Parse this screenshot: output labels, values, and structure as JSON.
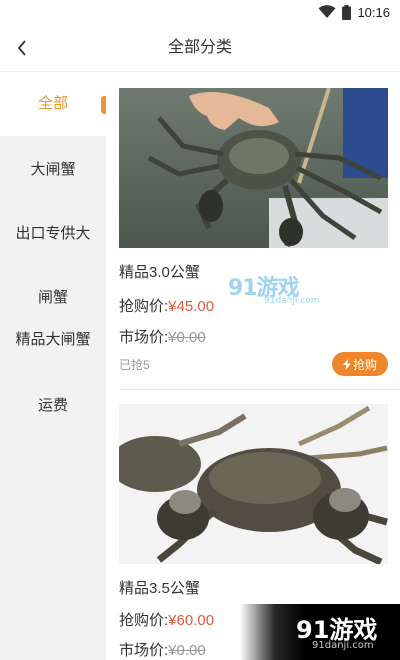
{
  "status_bar": {
    "time": "10:16"
  },
  "header": {
    "title": "全部分类"
  },
  "sidebar": {
    "items": [
      {
        "label": "全部"
      },
      {
        "label": "大闸蟹"
      },
      {
        "label": "出口专供大"
      },
      {
        "label": "闸蟹"
      },
      {
        "label": "精品大闸蟹"
      },
      {
        "label": "运费"
      }
    ]
  },
  "products": [
    {
      "name": "精品3.0公蟹",
      "buy_label": "抢购价:",
      "buy_price": "¥45.00",
      "market_label": "市场价:",
      "market_price": "¥0.00",
      "sold": "已抢5",
      "button": "抢购"
    },
    {
      "name": "精品3.5公蟹",
      "buy_label": "抢购价:",
      "buy_price": "¥60.00",
      "market_label": "市场价:",
      "market_price": "¥0.00"
    }
  ],
  "watermarks": [
    {
      "brand": "91游戏",
      "domain": "91danji.com"
    },
    {
      "brand": "91游戏",
      "domain": "91danji.com"
    }
  ],
  "colors": {
    "accent": "#f0932b",
    "price": "#e05a3a",
    "sidebar_bg": "#f2f2f2"
  }
}
